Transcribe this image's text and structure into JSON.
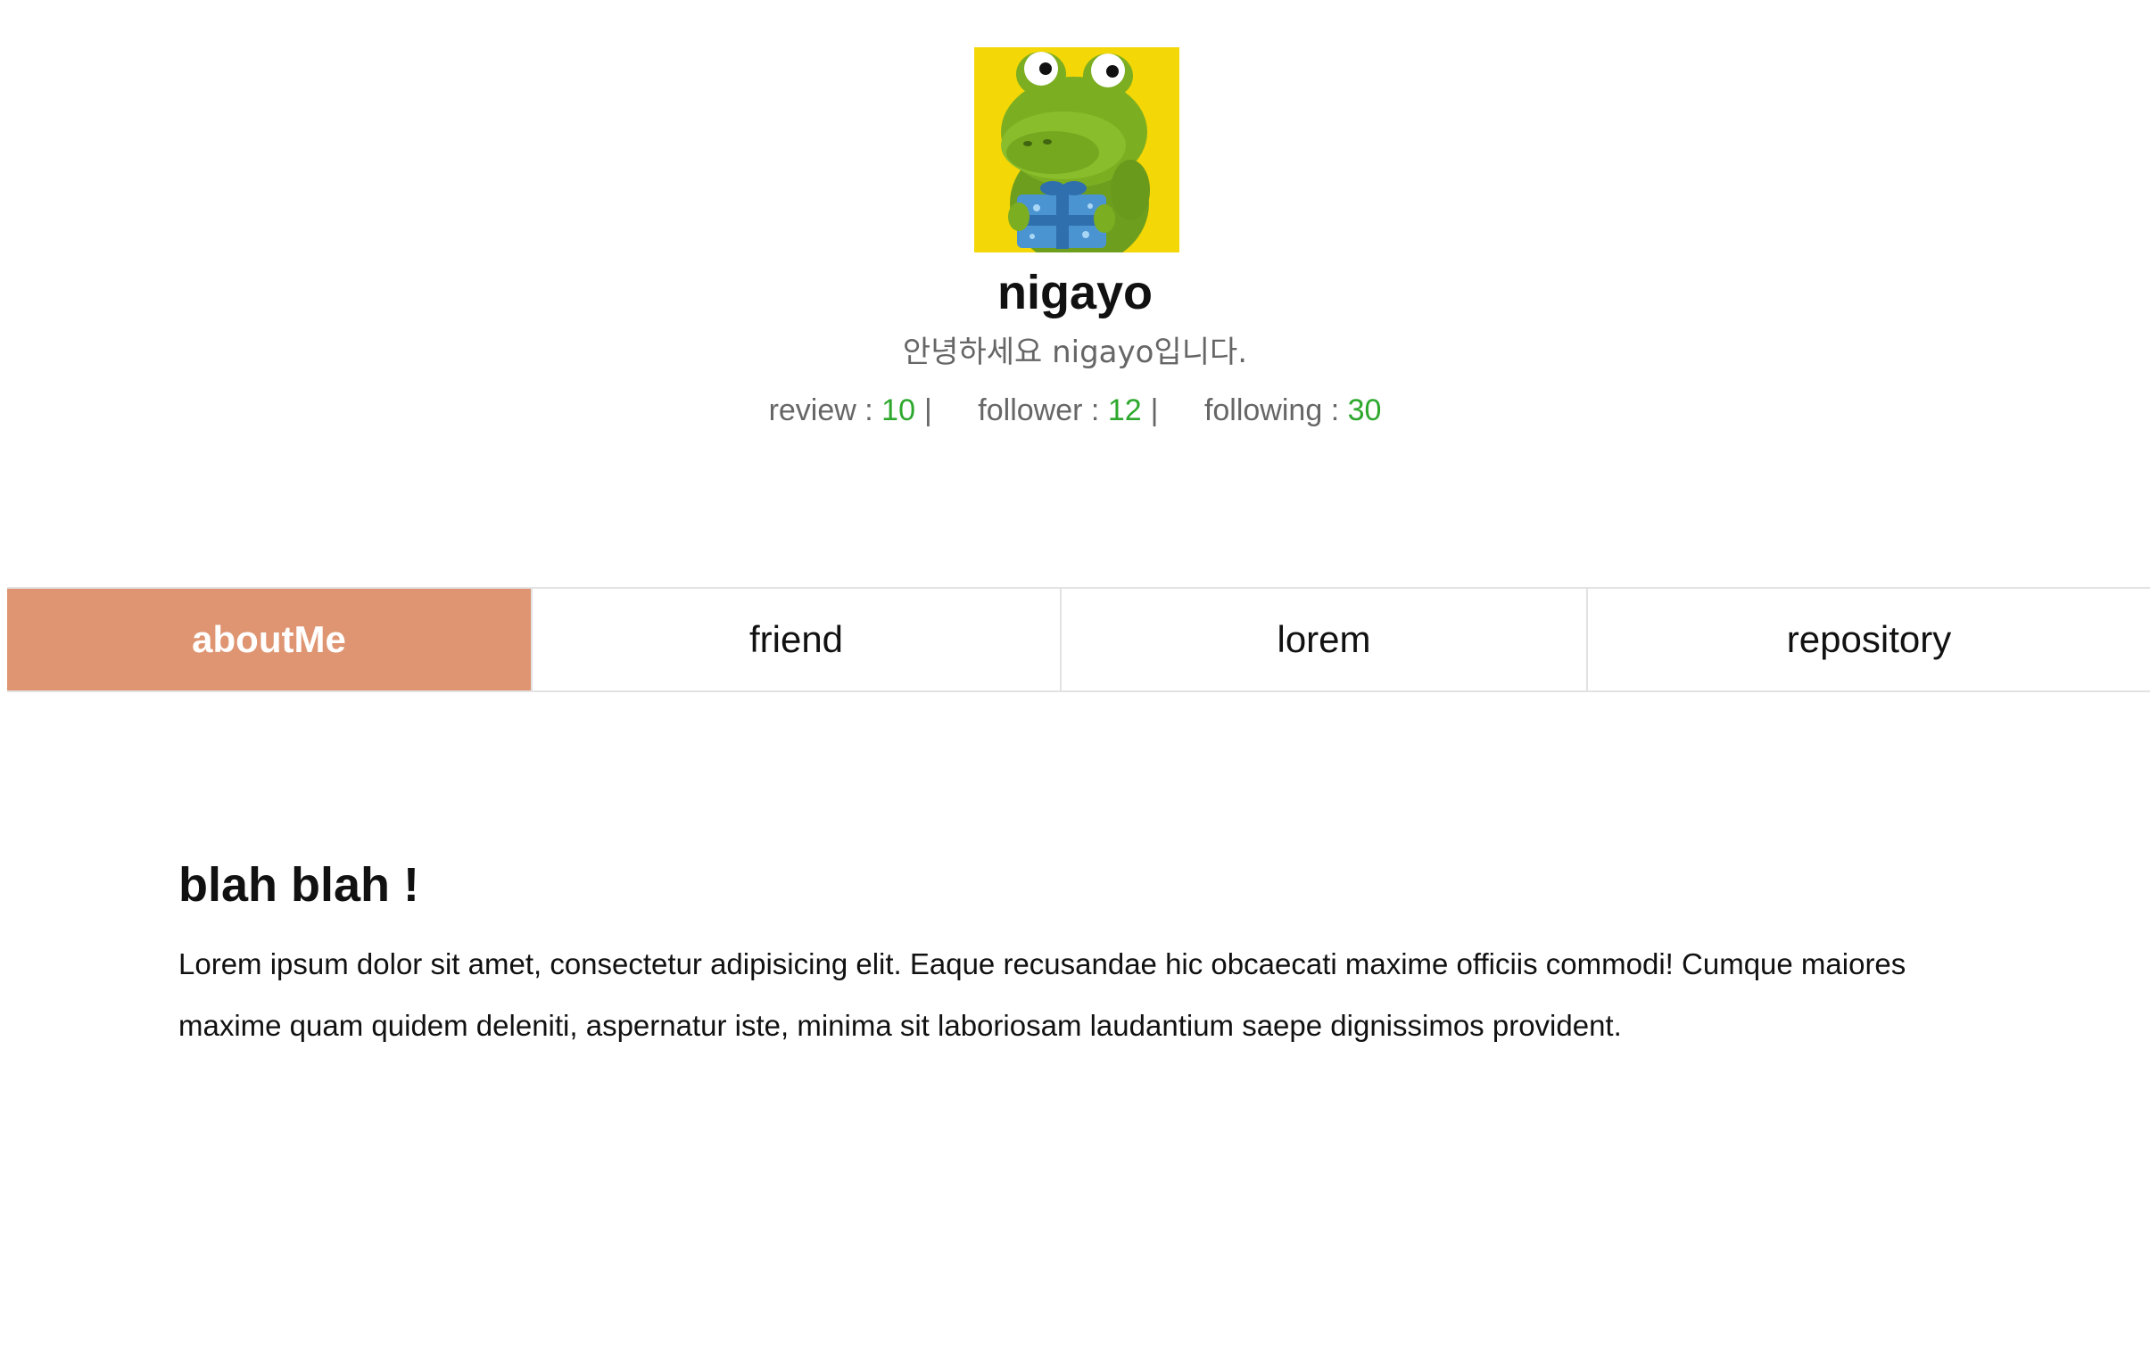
{
  "profile": {
    "avatar_alt": "green dinosaur character holding a blue gift box",
    "username": "nigayo",
    "greeting": "안녕하세요 nigayo입니다.",
    "stats": [
      {
        "label": "review",
        "value": "10"
      },
      {
        "label": "follower",
        "value": "12"
      },
      {
        "label": "following",
        "value": "30"
      }
    ],
    "stat_colon": " : ",
    "stat_separator": "|"
  },
  "tabs": [
    {
      "label": "aboutMe",
      "active": true
    },
    {
      "label": "friend",
      "active": false
    },
    {
      "label": "lorem",
      "active": false
    },
    {
      "label": "repository",
      "active": false
    }
  ],
  "content": {
    "heading": "blah blah !",
    "body": "Lorem ipsum dolor sit amet, consectetur adipisicing elit. Eaque recusandae hic obcaecati maxime officiis commodi! Cumque maiores maxime quam quidem deleniti, aspernatur iste, minima sit laboriosam laudantium saepe dignissimos provident."
  },
  "colors": {
    "active_tab": "#df9572",
    "stat_number": "#2da82d",
    "avatar_background": "#f5dc0a"
  }
}
